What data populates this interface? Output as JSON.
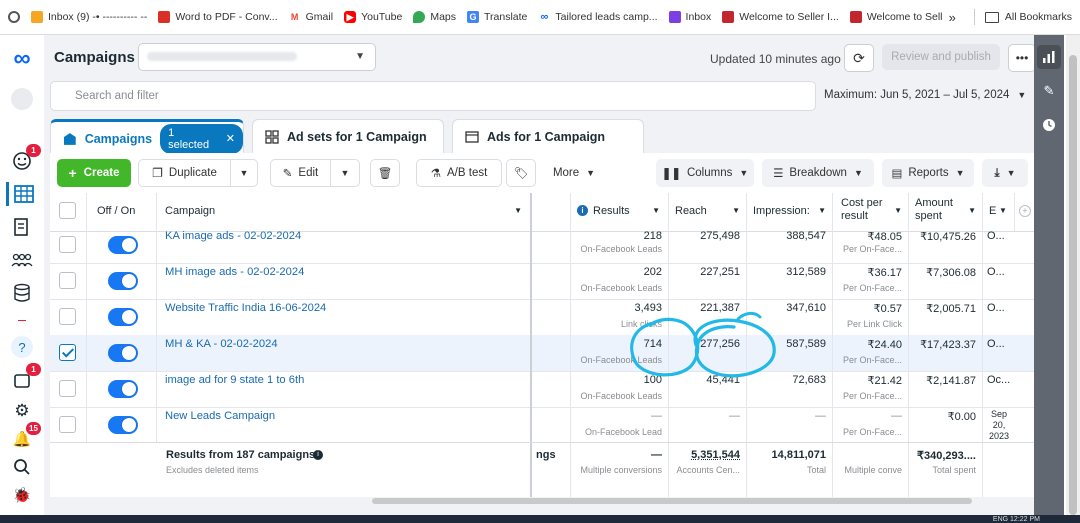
{
  "browser": {
    "bookmarks": [
      {
        "label": "Inbox (9) -• ---------- --",
        "icon": "mail-icon",
        "color": "#f5a623"
      },
      {
        "label": "Word to PDF - Conv...",
        "icon": "document-icon",
        "color": "#d93025"
      },
      {
        "label": "Gmail",
        "icon": "gmail-icon",
        "color": "#ea4335"
      },
      {
        "label": "YouTube",
        "icon": "youtube-icon",
        "color": "#ff0000"
      },
      {
        "label": "Maps",
        "icon": "maps-icon",
        "color": "#34a853"
      },
      {
        "label": "Translate",
        "icon": "translate-icon",
        "color": "#4285f4"
      },
      {
        "label": "Tailored leads camp...",
        "icon": "meta-icon",
        "color": "#0866ff"
      },
      {
        "label": "Inbox",
        "icon": "inbox-icon",
        "color": "#7b3fe4"
      },
      {
        "label": "Welcome to Seller I...",
        "icon": "seller-icon",
        "color": "#c1272d"
      },
      {
        "label": "Welcome to Seller I...",
        "icon": "seller-icon",
        "color": "#c1272d"
      }
    ],
    "overflow_label": "»",
    "all_bookmarks": "All Bookmarks"
  },
  "sidebar": {
    "badges": {
      "notifications": "1",
      "pages": "1",
      "alerts": "15"
    }
  },
  "header": {
    "title": "Campaigns",
    "updated": "Updated 10 minutes ago",
    "review_publish": "Review and publish",
    "more": "•••"
  },
  "search": {
    "placeholder": "Search and filter",
    "date_range": "Maximum: Jun 5, 2021 – Jul 5, 2024"
  },
  "tabs": {
    "campaigns": "Campaigns",
    "selected": "1 selected",
    "adsets": "Ad sets for 1 Campaign",
    "ads": "Ads for 1 Campaign"
  },
  "toolbar": {
    "create": "Create",
    "duplicate": "Duplicate",
    "edit": "Edit",
    "abtest": "A/B test",
    "more": "More",
    "columns": "Columns",
    "breakdown": "Breakdown",
    "reports": "Reports"
  },
  "table": {
    "headers": {
      "offon": "Off / On",
      "campaign": "Campaign",
      "results": "Results",
      "reach": "Reach",
      "impressions": "Impression:",
      "cost1": "Cost per",
      "cost2": "result",
      "amount1": "Amount",
      "amount2": "spent",
      "ends": "E"
    },
    "rows": [
      {
        "name": "KA image ads - 02-02-2024",
        "results": "218",
        "results_sub": "On-Facebook Leads",
        "reach": "275,498",
        "impressions": "388,547",
        "cost": "₹48.05",
        "cost_sub": "Per On-Face...",
        "amount": "₹10,475.26",
        "ends": "O...",
        "selected": false
      },
      {
        "name": "MH image ads - 02-02-2024",
        "results": "202",
        "results_sub": "On-Facebook Leads",
        "reach": "227,251",
        "impressions": "312,589",
        "cost": "₹36.17",
        "cost_sub": "Per On-Face...",
        "amount": "₹7,306.08",
        "ends": "O...",
        "selected": false
      },
      {
        "name": "Website Traffic India 16-06-2024",
        "results": "3,493",
        "results_sub": "Link clicks",
        "reach": "221,387",
        "impressions": "347,610",
        "cost": "₹0.57",
        "cost_sub": "Per Link Click",
        "amount": "₹2,005.71",
        "ends": "O...",
        "selected": false
      },
      {
        "name": "MH & KA - 02-02-2024",
        "results": "714",
        "results_sub": "On-Facebook Leads",
        "reach": "277,256",
        "impressions": "587,589",
        "cost": "₹24.40",
        "cost_sub": "Per On-Face...",
        "amount": "₹17,423.37",
        "ends": "O...",
        "selected": true
      },
      {
        "name": "image ad for 9 state 1 to 6th",
        "results": "100",
        "results_sub": "On-Facebook Leads",
        "reach": "45,441",
        "impressions": "72,683",
        "cost": "₹21.42",
        "cost_sub": "Per On-Face...",
        "amount": "₹2,141.87",
        "ends": "Oc...",
        "selected": false
      },
      {
        "name": "New Leads Campaign",
        "results": "—",
        "results_sub": "On-Facebook Lead",
        "reach": "—",
        "impressions": "—",
        "cost": "—",
        "cost_sub": "Per On-Face...",
        "amount": "₹0.00",
        "ends": "Sep 20, 2023",
        "selected": false
      }
    ],
    "summary": {
      "title": "Results from 187 campaigns",
      "sub": "Excludes deleted items",
      "cut": "ngs",
      "results": "—",
      "results_sub": "Multiple conversions",
      "reach": "5,351,544",
      "reach_sub": "Accounts Cen...",
      "impressions": "14,811,071",
      "impressions_sub": "Total",
      "cost_sub": "Multiple conve",
      "amount": "₹340,293....",
      "amount_sub": "Total spent"
    }
  },
  "taskbar": {
    "lang": "ENG",
    "time": "12:22 PM"
  }
}
